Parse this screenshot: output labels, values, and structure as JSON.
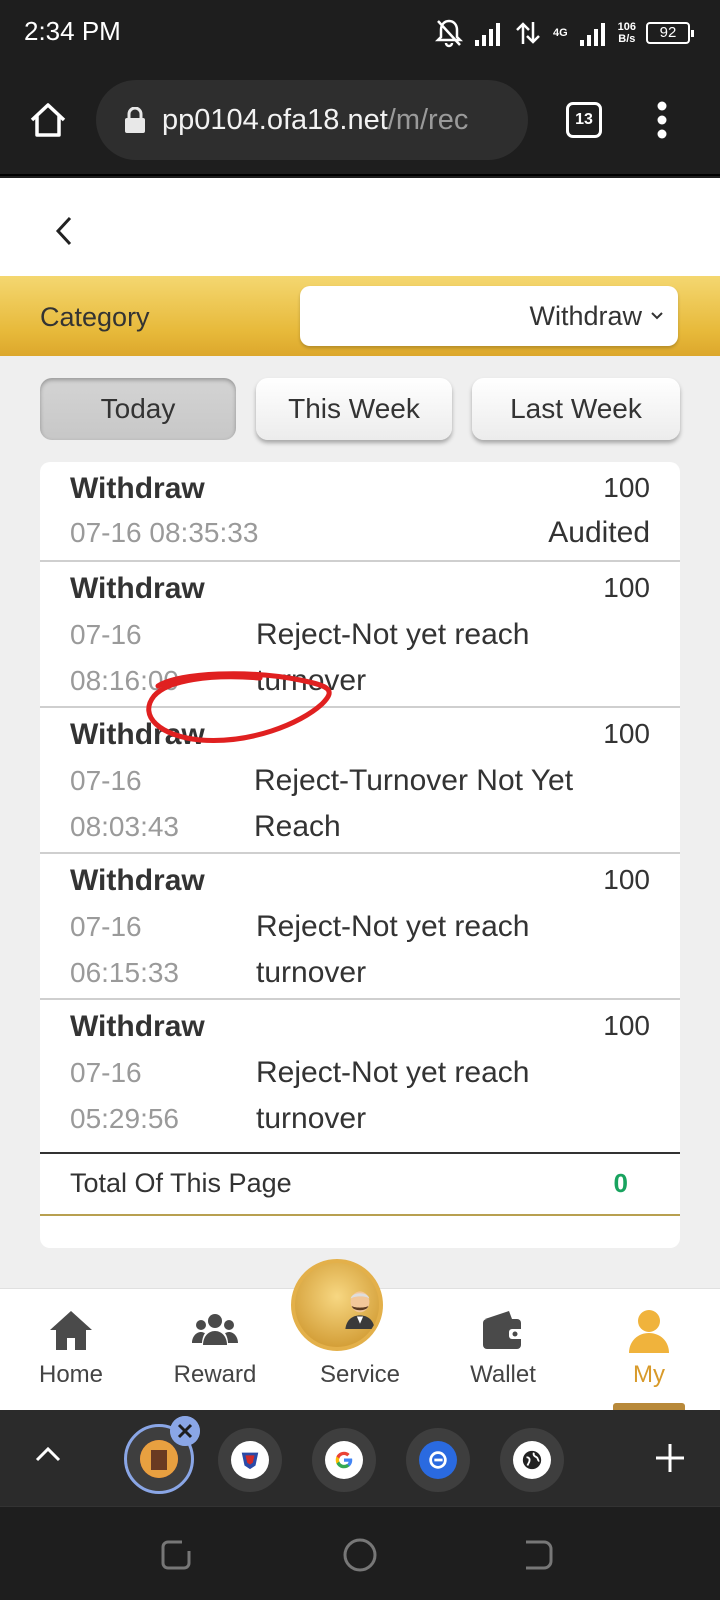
{
  "status_bar": {
    "time": "2:34 PM",
    "network_type": "4G",
    "speed_value": "106",
    "speed_unit": "B/s",
    "battery": "92"
  },
  "browser": {
    "url_host": "pp0104.ofa18.net",
    "url_path": "/m/rec",
    "tab_count": "13"
  },
  "filter": {
    "category_label": "Category",
    "category_value": "Withdraw"
  },
  "periods": [
    "Today",
    "This Week",
    "Last Week"
  ],
  "records": [
    {
      "title": "Withdraw",
      "amount": "100",
      "date": "07-16",
      "time": "08:35:33",
      "status": "Audited"
    },
    {
      "title": "Withdraw",
      "amount": "100",
      "date": "07-16",
      "time": "08:16:00",
      "status_line1": "Reject-Not yet reach",
      "status_line2": "turnover"
    },
    {
      "title": "Withdraw",
      "amount": "100",
      "date": "07-16",
      "time": "08:03:43",
      "status_line1": "Reject-Turnover Not Yet",
      "status_line2": "Reach"
    },
    {
      "title": "Withdraw",
      "amount": "100",
      "date": "07-16",
      "time": "06:15:33",
      "status_line1": "Reject-Not yet reach",
      "status_line2": "turnover"
    },
    {
      "title": "Withdraw",
      "amount": "100",
      "date": "07-16",
      "time": "05:29:56",
      "status_line1": "Reject-Not yet reach",
      "status_line2": "turnover"
    }
  ],
  "total": {
    "label": "Total Of This Page",
    "value": "0"
  },
  "bottom_nav": {
    "items": [
      "Home",
      "Reward",
      "Service",
      "Wallet",
      "My"
    ],
    "active": "My"
  },
  "colors": {
    "accent_gold": "#e7b93a",
    "total_green": "#19a35f",
    "active_tab": "#d89a2a",
    "annotation_red": "#e02020"
  },
  "icons": [
    "home-icon",
    "lock-icon",
    "tabs-icon",
    "overflow-menu-icon",
    "back-icon",
    "chevron-down-icon",
    "reward-icon",
    "wallet-icon",
    "profile-icon"
  ]
}
